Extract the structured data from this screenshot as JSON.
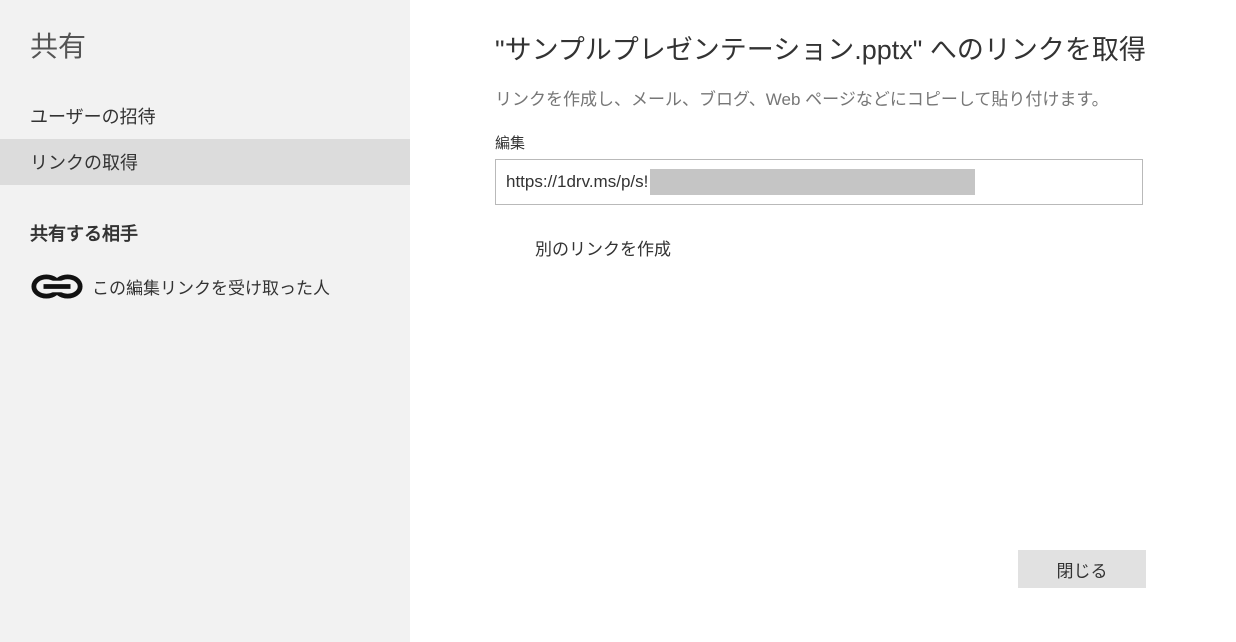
{
  "sidebar": {
    "title": "共有",
    "items": [
      {
        "label": "ユーザーの招待"
      },
      {
        "label": "リンクの取得"
      }
    ],
    "subheading": "共有する相手",
    "share_entry": {
      "label": "この編集リンクを受け取った人"
    }
  },
  "main": {
    "title": "\"サンプルプレゼンテーション.pptx\" へのリンクを取得",
    "description": "リンクを作成し、メール、ブログ、Web ページなどにコピーして貼り付けます。",
    "field_label": "編集",
    "link_value": "https://1drv.ms/p/s!",
    "create_another_label": "別のリンクを作成",
    "close_label": "閉じる"
  }
}
